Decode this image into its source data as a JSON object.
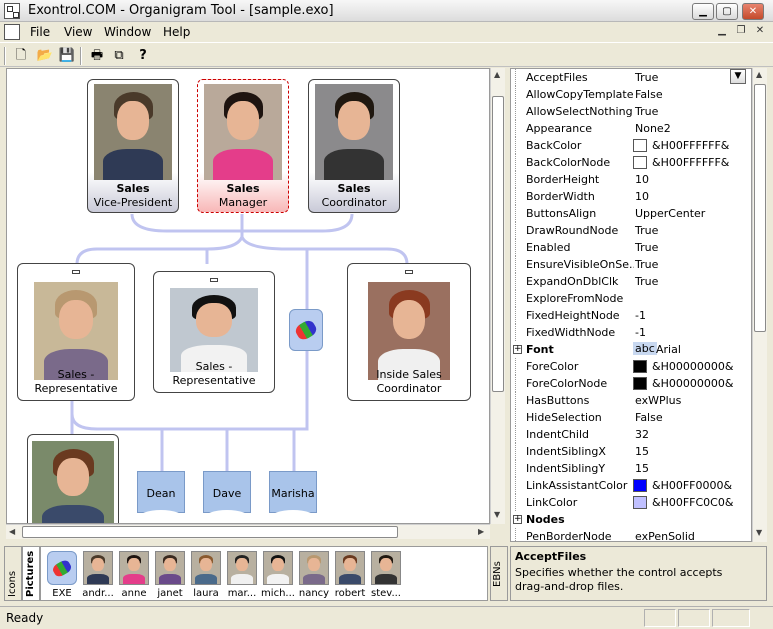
{
  "window": {
    "title": "Exontrol.COM - Organigram Tool - [sample.exo]"
  },
  "menu": {
    "items": [
      "File",
      "View",
      "Window",
      "Help"
    ],
    "accels": [
      "F",
      "V",
      "W",
      "H"
    ]
  },
  "toolbar": {
    "buttons": [
      "new-file-icon",
      "open-folder-icon",
      "save-icon",
      "print-icon",
      "copy-icon",
      "help-icon"
    ]
  },
  "chart": {
    "nodes": [
      {
        "id": "vp",
        "line1": "Sales",
        "line2": "Vice-President",
        "style": "grey"
      },
      {
        "id": "mgr",
        "line1": "Sales",
        "line2": "Manager",
        "style": "pink"
      },
      {
        "id": "coord",
        "line1": "Sales",
        "line2": "Coordinator",
        "style": "grey"
      },
      {
        "id": "rep1",
        "line1": "Sales - Representative"
      },
      {
        "id": "rep2",
        "line1": "Sales - Representative"
      },
      {
        "id": "isc",
        "line1": "Inside Sales Coordinator"
      }
    ],
    "docs": [
      "Dean",
      "Dave",
      "Marisha"
    ]
  },
  "properties": [
    {
      "name": "AcceptFiles",
      "value": "True"
    },
    {
      "name": "AllowCopyTemplate",
      "value": "False"
    },
    {
      "name": "AllowSelectNothing",
      "value": "True"
    },
    {
      "name": "Appearance",
      "value": "None2"
    },
    {
      "name": "BackColor",
      "value": "&H00FFFFFF&",
      "swatch": "#ffffff"
    },
    {
      "name": "BackColorNode",
      "value": "&H00FFFFFF&",
      "swatch": "#ffffff"
    },
    {
      "name": "BorderHeight",
      "value": "10"
    },
    {
      "name": "BorderWidth",
      "value": "10"
    },
    {
      "name": "ButtonsAlign",
      "value": "UpperCenter"
    },
    {
      "name": "DrawRoundNode",
      "value": "True"
    },
    {
      "name": "Enabled",
      "value": "True"
    },
    {
      "name": "EnsureVisibleOnSe...",
      "value": "True"
    },
    {
      "name": "ExpandOnDblClk",
      "value": "True"
    },
    {
      "name": "ExploreFromNode",
      "value": ""
    },
    {
      "name": "FixedHeightNode",
      "value": "-1"
    },
    {
      "name": "FixedWidthNode",
      "value": "-1"
    },
    {
      "name": "Font",
      "value": "Arial",
      "group": true,
      "badge": "abc"
    },
    {
      "name": "ForeColor",
      "value": "&H00000000&",
      "swatch": "#000000"
    },
    {
      "name": "ForeColorNode",
      "value": "&H00000000&",
      "swatch": "#000000"
    },
    {
      "name": "HasButtons",
      "value": "exWPlus"
    },
    {
      "name": "HideSelection",
      "value": "False"
    },
    {
      "name": "IndentChild",
      "value": "32"
    },
    {
      "name": "IndentSiblingX",
      "value": "15"
    },
    {
      "name": "IndentSiblingY",
      "value": "15"
    },
    {
      "name": "LinkAssistantColor",
      "value": "&H00FF0000&",
      "swatch": "#0000ff"
    },
    {
      "name": "LinkColor",
      "value": "&H00FFC0C0&",
      "swatch": "#c0c0ff"
    },
    {
      "name": "Nodes",
      "value": "",
      "group": true
    },
    {
      "name": "PenBorderNode",
      "value": "exPenSolid"
    }
  ],
  "description": {
    "title": "AcceptFiles",
    "body": "Specifies whether the control accepts drag-and-drop files."
  },
  "tabs": {
    "icons": "Icons",
    "pictures": "Pictures",
    "ebns": "EBNs"
  },
  "pictures": [
    "EXE",
    "andr...",
    "anne",
    "janet",
    "laura",
    "mar...",
    "mich...",
    "nancy",
    "robert",
    "stev..."
  ],
  "status": {
    "text": "Ready"
  },
  "colors": {
    "link": "#c0c4f0",
    "select": "#c00000"
  }
}
